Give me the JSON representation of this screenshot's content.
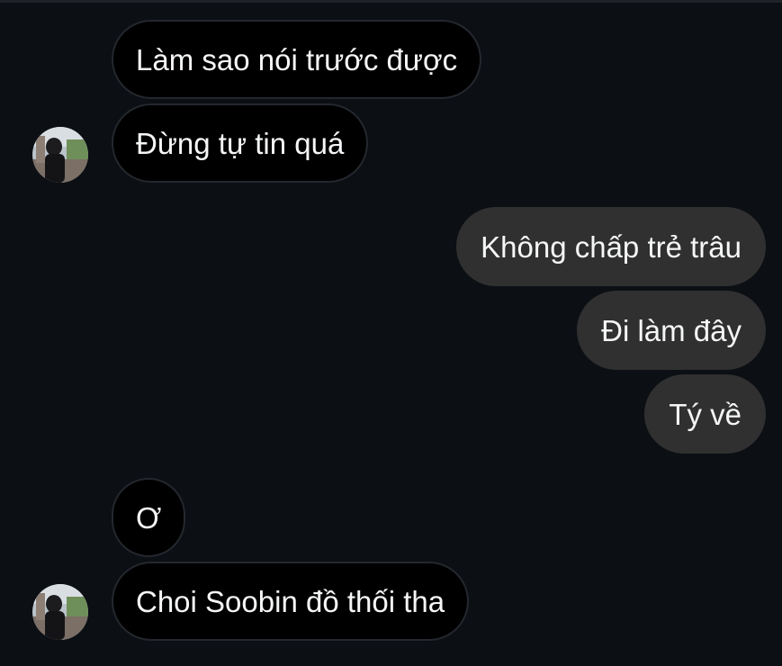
{
  "messages": [
    {
      "id": "m1",
      "direction": "incoming",
      "text": "Làm sao nói trước được"
    },
    {
      "id": "m2",
      "direction": "incoming",
      "text": "Đừng tự tin quá"
    },
    {
      "id": "m3",
      "direction": "outgoing",
      "text": "Không chấp trẻ trâu"
    },
    {
      "id": "m4",
      "direction": "outgoing",
      "text": "Đi làm đây"
    },
    {
      "id": "m5",
      "direction": "outgoing",
      "text": "Tý về"
    },
    {
      "id": "m6",
      "direction": "incoming",
      "text": "Ơ"
    },
    {
      "id": "m7",
      "direction": "incoming",
      "text": "Choi Soobin đồ thối tha"
    }
  ],
  "colors": {
    "background": "#0c0f14",
    "incoming_bubble": "#000000",
    "incoming_border": "#24282e",
    "outgoing_bubble": "#303030",
    "text": "#f5f6f7"
  },
  "icons": {
    "avatar": "contact-avatar-photo"
  }
}
